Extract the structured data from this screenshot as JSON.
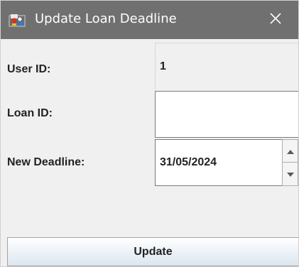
{
  "window": {
    "title": "Update Loan Deadline",
    "icon": "java-app-icon",
    "close_icon": "close-icon"
  },
  "form": {
    "user_id_label": "User ID:",
    "user_id_value": "1",
    "loan_id_label": "Loan ID:",
    "loan_id_value": "",
    "deadline_label": "New Deadline:",
    "deadline_value": "31/05/2024"
  },
  "actions": {
    "update_label": "Update"
  }
}
